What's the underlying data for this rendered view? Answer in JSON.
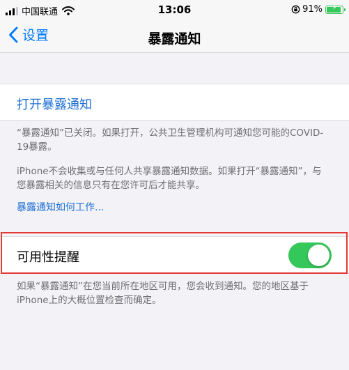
{
  "status_bar": {
    "carrier": "中国联通",
    "time": "13:06",
    "battery_percent": "91%",
    "battery_level": 0.91,
    "icons": [
      "signal-icon",
      "wifi-icon",
      "orientation-lock-icon",
      "battery-icon"
    ]
  },
  "nav": {
    "back_label": "设置",
    "title": "暴露通知"
  },
  "main": {
    "open_link": "打开暴露通知",
    "footer_1": "“暴露通知”已关闭。如果打开，公共卫生管理机构可通知您可能的COVID-19暴露。",
    "footer_2": "iPhone不会收集或与任何人共享暴露通知数据。如果打开“暴露通知”，与您暴露相关的信息只有在您许可后才能共享。",
    "how_link": "暴露通知如何工作...",
    "availability_label": "可用性提醒",
    "availability_on": true,
    "footer_3": "如果“暴露通知”在您当前所在地区可用，您会收到通知。您的地区基于iPhone上的大概位置检查而确定。"
  },
  "colors": {
    "accent": "#007aff",
    "toggle_on": "#34c759",
    "highlight": "#e53935",
    "background": "#f2f2f7"
  }
}
